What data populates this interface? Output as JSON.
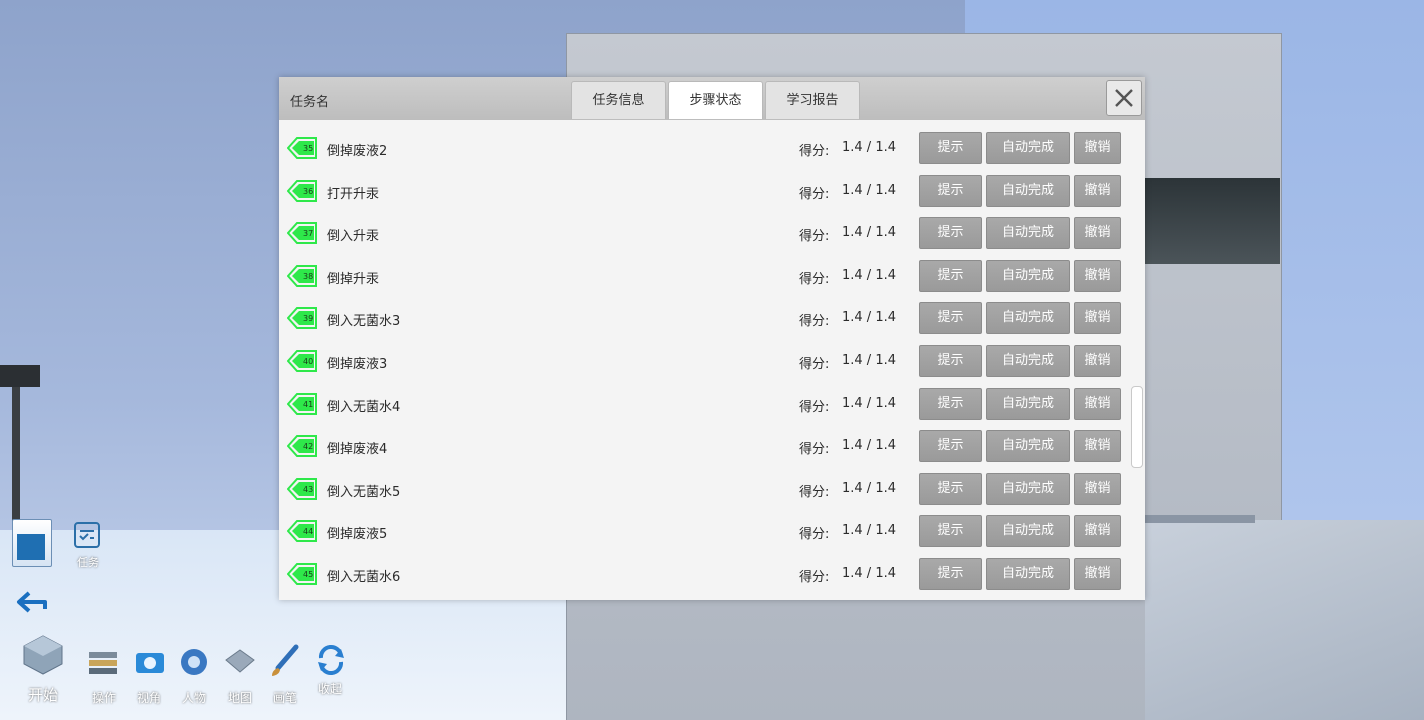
{
  "dialog": {
    "title": "任务名",
    "tabs": [
      {
        "label": "任务信息"
      },
      {
        "label": "步骤状态"
      },
      {
        "label": "学习报告"
      }
    ],
    "active_tab": "步骤状态"
  },
  "steps": [
    {
      "num": "35",
      "name": "倒掉废液2",
      "score_label": "得分:",
      "score": "1.4 / 1.4"
    },
    {
      "num": "36",
      "name": "打开升汞",
      "score_label": "得分:",
      "score": "1.4 / 1.4"
    },
    {
      "num": "37",
      "name": "倒入升汞",
      "score_label": "得分:",
      "score": "1.4 / 1.4"
    },
    {
      "num": "38",
      "name": "倒掉升汞",
      "score_label": "得分:",
      "score": "1.4 / 1.4"
    },
    {
      "num": "39",
      "name": "倒入无菌水3",
      "score_label": "得分:",
      "score": "1.4 / 1.4"
    },
    {
      "num": "40",
      "name": "倒掉废液3",
      "score_label": "得分:",
      "score": "1.4 / 1.4"
    },
    {
      "num": "41",
      "name": "倒入无菌水4",
      "score_label": "得分:",
      "score": "1.4 / 1.4"
    },
    {
      "num": "42",
      "name": "倒掉废液4",
      "score_label": "得分:",
      "score": "1.4 / 1.4"
    },
    {
      "num": "43",
      "name": "倒入无菌水5",
      "score_label": "得分:",
      "score": "1.4 / 1.4"
    },
    {
      "num": "44",
      "name": "倒掉废液5",
      "score_label": "得分:",
      "score": "1.4 / 1.4"
    },
    {
      "num": "45",
      "name": "倒入无菌水6",
      "score_label": "得分:",
      "score": "1.4 / 1.4"
    }
  ],
  "row_buttons": {
    "hint": "提示",
    "auto": "自动完成",
    "undo": "撤销"
  },
  "side": {
    "task_label": "任务"
  },
  "toolbar": {
    "start": "开始",
    "items": [
      "操作",
      "视角",
      "人物",
      "地图",
      "画笔",
      "收起"
    ]
  },
  "colors": {
    "step_icon": "#2ee84a",
    "button": "#9f9f9f"
  }
}
